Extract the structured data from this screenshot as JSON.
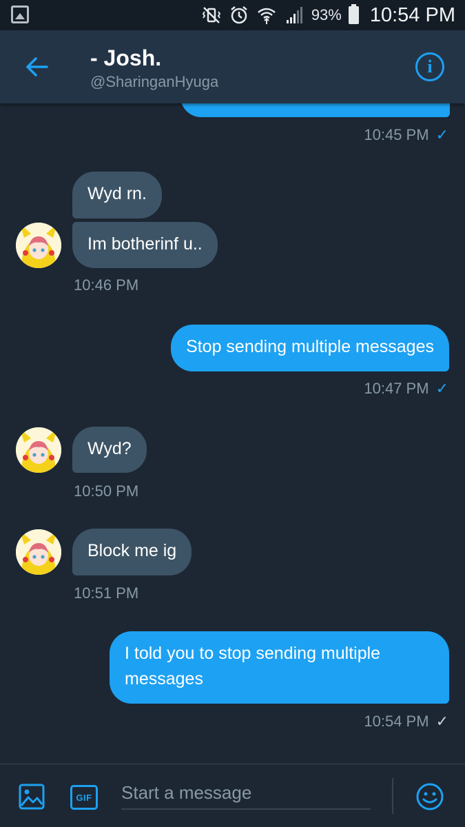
{
  "status_bar": {
    "battery": "93%",
    "time": "10:54 PM"
  },
  "header": {
    "name": "- Josh.",
    "handle": "@SharinganHyuga",
    "back_icon": "arrow-left-icon",
    "info_icon": "info-icon"
  },
  "messages": [
    {
      "from": "me",
      "text": "",
      "time": "10:45 PM",
      "status": "read"
    },
    {
      "from": "them",
      "text": "Wyd rn."
    },
    {
      "from": "them",
      "text": "Im botherinf u..",
      "time": "10:46 PM"
    },
    {
      "from": "me",
      "text": "Stop sending multiple messages",
      "time": "10:47 PM",
      "status": "read"
    },
    {
      "from": "them",
      "text": "Wyd?",
      "time": "10:50 PM"
    },
    {
      "from": "them",
      "text": "Block me ig",
      "time": "10:51 PM"
    },
    {
      "from": "me",
      "text": "I told you to stop sending multiple messages",
      "time": "10:54 PM",
      "status": "sent"
    }
  ],
  "checkmark": "✓",
  "composer": {
    "placeholder": "Start a message",
    "gif_label": "GIF"
  },
  "colors": {
    "background": "#1c2733",
    "header": "#243447",
    "accent": "#1da1f2",
    "incoming_bubble": "#3d5466",
    "muted_text": "#8899a6"
  }
}
